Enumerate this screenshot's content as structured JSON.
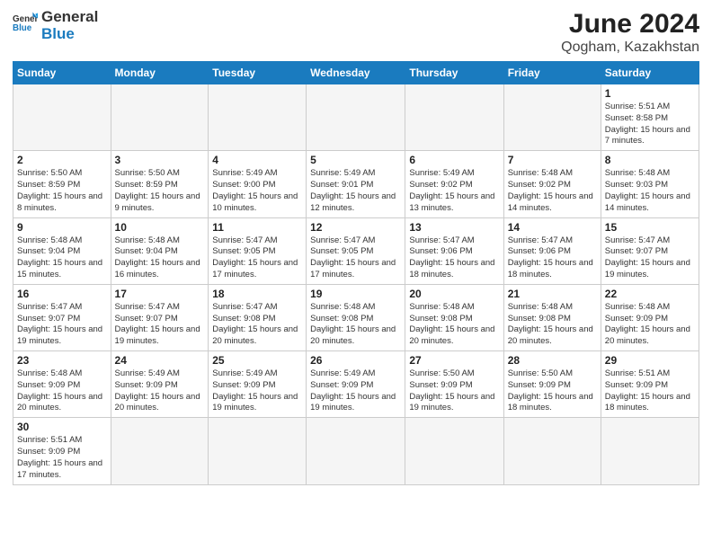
{
  "header": {
    "logo_general": "General",
    "logo_blue": "Blue",
    "month_year": "June 2024",
    "location": "Qogham, Kazakhstan"
  },
  "days_of_week": [
    "Sunday",
    "Monday",
    "Tuesday",
    "Wednesday",
    "Thursday",
    "Friday",
    "Saturday"
  ],
  "weeks": [
    [
      {
        "day": "",
        "info": ""
      },
      {
        "day": "",
        "info": ""
      },
      {
        "day": "",
        "info": ""
      },
      {
        "day": "",
        "info": ""
      },
      {
        "day": "",
        "info": ""
      },
      {
        "day": "",
        "info": ""
      },
      {
        "day": "1",
        "info": "Sunrise: 5:51 AM\nSunset: 8:58 PM\nDaylight: 15 hours\nand 7 minutes."
      }
    ],
    [
      {
        "day": "2",
        "info": "Sunrise: 5:50 AM\nSunset: 8:59 PM\nDaylight: 15 hours\nand 8 minutes."
      },
      {
        "day": "3",
        "info": "Sunrise: 5:50 AM\nSunset: 8:59 PM\nDaylight: 15 hours\nand 9 minutes."
      },
      {
        "day": "4",
        "info": "Sunrise: 5:49 AM\nSunset: 9:00 PM\nDaylight: 15 hours\nand 10 minutes."
      },
      {
        "day": "5",
        "info": "Sunrise: 5:49 AM\nSunset: 9:01 PM\nDaylight: 15 hours\nand 12 minutes."
      },
      {
        "day": "6",
        "info": "Sunrise: 5:49 AM\nSunset: 9:02 PM\nDaylight: 15 hours\nand 13 minutes."
      },
      {
        "day": "7",
        "info": "Sunrise: 5:48 AM\nSunset: 9:02 PM\nDaylight: 15 hours\nand 14 minutes."
      },
      {
        "day": "8",
        "info": "Sunrise: 5:48 AM\nSunset: 9:03 PM\nDaylight: 15 hours\nand 14 minutes."
      }
    ],
    [
      {
        "day": "9",
        "info": "Sunrise: 5:48 AM\nSunset: 9:04 PM\nDaylight: 15 hours\nand 15 minutes."
      },
      {
        "day": "10",
        "info": "Sunrise: 5:48 AM\nSunset: 9:04 PM\nDaylight: 15 hours\nand 16 minutes."
      },
      {
        "day": "11",
        "info": "Sunrise: 5:47 AM\nSunset: 9:05 PM\nDaylight: 15 hours\nand 17 minutes."
      },
      {
        "day": "12",
        "info": "Sunrise: 5:47 AM\nSunset: 9:05 PM\nDaylight: 15 hours\nand 17 minutes."
      },
      {
        "day": "13",
        "info": "Sunrise: 5:47 AM\nSunset: 9:06 PM\nDaylight: 15 hours\nand 18 minutes."
      },
      {
        "day": "14",
        "info": "Sunrise: 5:47 AM\nSunset: 9:06 PM\nDaylight: 15 hours\nand 18 minutes."
      },
      {
        "day": "15",
        "info": "Sunrise: 5:47 AM\nSunset: 9:07 PM\nDaylight: 15 hours\nand 19 minutes."
      }
    ],
    [
      {
        "day": "16",
        "info": "Sunrise: 5:47 AM\nSunset: 9:07 PM\nDaylight: 15 hours\nand 19 minutes."
      },
      {
        "day": "17",
        "info": "Sunrise: 5:47 AM\nSunset: 9:07 PM\nDaylight: 15 hours\nand 19 minutes."
      },
      {
        "day": "18",
        "info": "Sunrise: 5:47 AM\nSunset: 9:08 PM\nDaylight: 15 hours\nand 20 minutes."
      },
      {
        "day": "19",
        "info": "Sunrise: 5:48 AM\nSunset: 9:08 PM\nDaylight: 15 hours\nand 20 minutes."
      },
      {
        "day": "20",
        "info": "Sunrise: 5:48 AM\nSunset: 9:08 PM\nDaylight: 15 hours\nand 20 minutes."
      },
      {
        "day": "21",
        "info": "Sunrise: 5:48 AM\nSunset: 9:08 PM\nDaylight: 15 hours\nand 20 minutes."
      },
      {
        "day": "22",
        "info": "Sunrise: 5:48 AM\nSunset: 9:09 PM\nDaylight: 15 hours\nand 20 minutes."
      }
    ],
    [
      {
        "day": "23",
        "info": "Sunrise: 5:48 AM\nSunset: 9:09 PM\nDaylight: 15 hours\nand 20 minutes."
      },
      {
        "day": "24",
        "info": "Sunrise: 5:49 AM\nSunset: 9:09 PM\nDaylight: 15 hours\nand 20 minutes."
      },
      {
        "day": "25",
        "info": "Sunrise: 5:49 AM\nSunset: 9:09 PM\nDaylight: 15 hours\nand 19 minutes."
      },
      {
        "day": "26",
        "info": "Sunrise: 5:49 AM\nSunset: 9:09 PM\nDaylight: 15 hours\nand 19 minutes."
      },
      {
        "day": "27",
        "info": "Sunrise: 5:50 AM\nSunset: 9:09 PM\nDaylight: 15 hours\nand 19 minutes."
      },
      {
        "day": "28",
        "info": "Sunrise: 5:50 AM\nSunset: 9:09 PM\nDaylight: 15 hours\nand 18 minutes."
      },
      {
        "day": "29",
        "info": "Sunrise: 5:51 AM\nSunset: 9:09 PM\nDaylight: 15 hours\nand 18 minutes."
      }
    ],
    [
      {
        "day": "30",
        "info": "Sunrise: 5:51 AM\nSunset: 9:09 PM\nDaylight: 15 hours\nand 17 minutes."
      },
      {
        "day": "",
        "info": ""
      },
      {
        "day": "",
        "info": ""
      },
      {
        "day": "",
        "info": ""
      },
      {
        "day": "",
        "info": ""
      },
      {
        "day": "",
        "info": ""
      },
      {
        "day": "",
        "info": ""
      }
    ]
  ]
}
